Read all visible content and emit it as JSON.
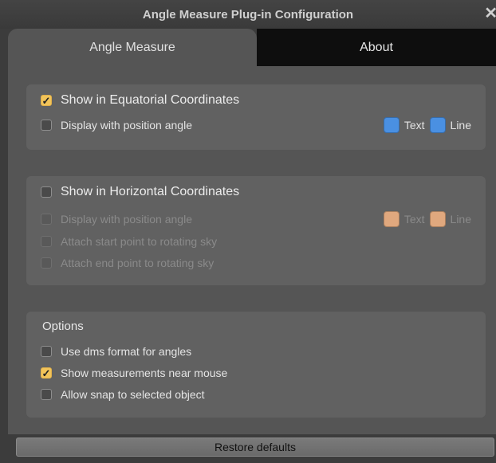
{
  "window": {
    "title": "Angle Measure Plug-in Configuration",
    "close_glyph": "✕"
  },
  "tabs": [
    {
      "label": "Angle Measure",
      "active": true
    },
    {
      "label": "About",
      "active": false
    }
  ],
  "equatorial": {
    "header": {
      "label": "Show in Equatorial Coordinates",
      "checked": true
    },
    "position_angle": {
      "label": "Display with position angle",
      "checked": false
    },
    "colors": {
      "color": "#4a90e2",
      "text_label": "Text",
      "line_label": "Line"
    }
  },
  "horizontal": {
    "header": {
      "label": "Show in Horizontal Coordinates",
      "checked": false
    },
    "position_angle": {
      "label": "Display with position angle",
      "checked": false
    },
    "attach_start": {
      "label": "Attach start point to rotating sky",
      "checked": false
    },
    "attach_end": {
      "label": "Attach end point to rotating sky",
      "checked": false
    },
    "colors": {
      "color": "#e0a87e",
      "text_label": "Text",
      "line_label": "Line"
    }
  },
  "options": {
    "title": "Options",
    "dms": {
      "label": "Use dms format for angles",
      "checked": false
    },
    "near_mouse": {
      "label": "Show measurements near mouse",
      "checked": true
    },
    "snap": {
      "label": "Allow snap to selected object",
      "checked": false
    }
  },
  "footer": {
    "restore_label": "Restore defaults"
  },
  "check_glyph": "✓"
}
